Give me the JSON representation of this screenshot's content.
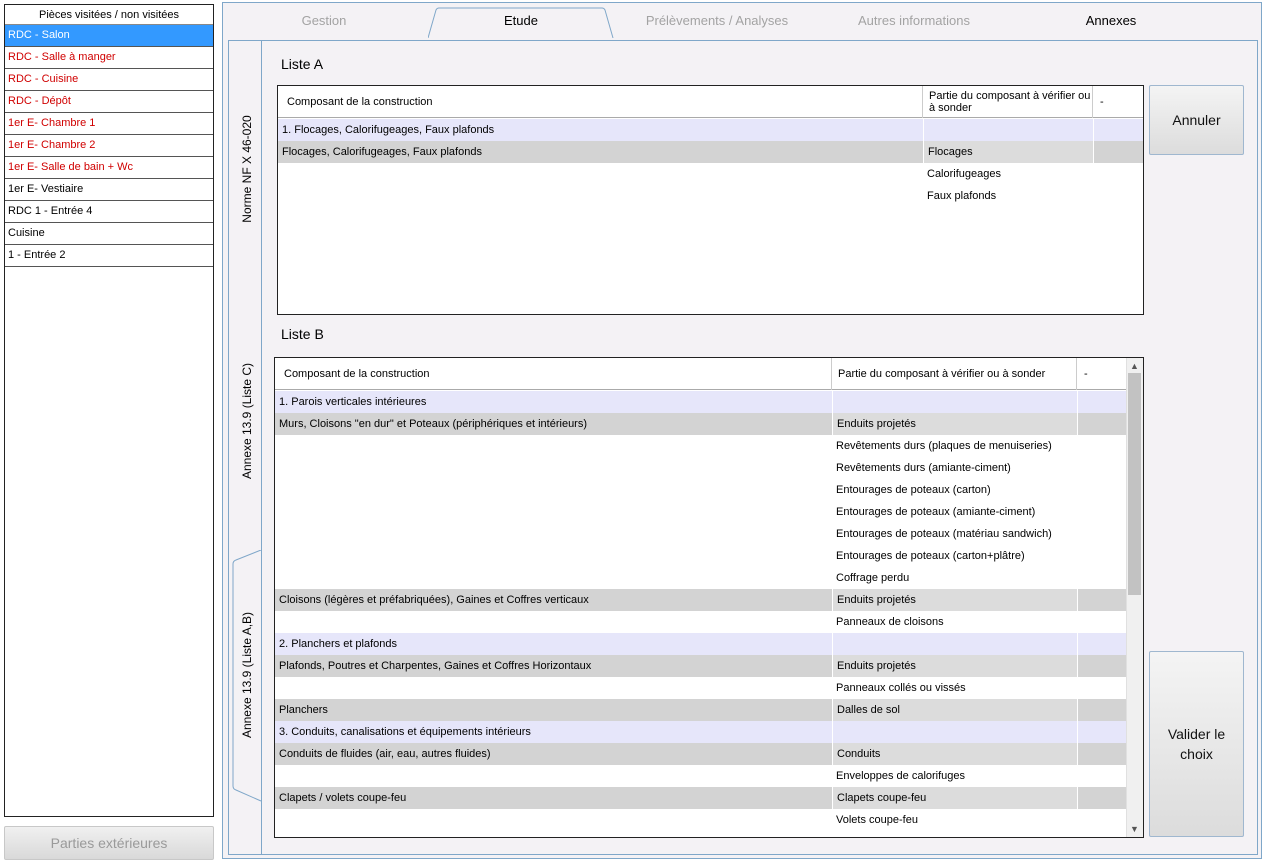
{
  "rooms": {
    "header": "Pièces visitées / non visitées",
    "items": [
      {
        "label": "RDC - Salon",
        "state": "selected"
      },
      {
        "label": "RDC - Salle à manger",
        "state": "red"
      },
      {
        "label": "RDC - Cuisine",
        "state": "red"
      },
      {
        "label": "RDC - Dépôt",
        "state": "red"
      },
      {
        "label": "1er E- Chambre 1",
        "state": "red"
      },
      {
        "label": "1er E- Chambre 2",
        "state": "red"
      },
      {
        "label": "1er E- Salle de bain + Wc",
        "state": "red"
      },
      {
        "label": "1er E- Vestiaire",
        "state": "normal"
      },
      {
        "label": "RDC 1 - Entrée 4",
        "state": "normal"
      },
      {
        "label": "Cuisine",
        "state": "normal"
      },
      {
        "label": "1 - Entrée 2",
        "state": "normal"
      }
    ],
    "exterior_button": "Parties extérieures"
  },
  "tabs": {
    "gestion": "Gestion",
    "etude": "Etude",
    "prelevements": "Prélèvements / Analyses",
    "autres": "Autres informations",
    "annexes": "Annexes"
  },
  "side_tabs": {
    "norme": "Norme NF X 46-020",
    "annexe_c": "Annexe 13.9 (Liste C)",
    "annexe_ab": "Annexe 13.9 (Liste A,B)"
  },
  "liste_a": {
    "title": "Liste A",
    "col1": "Composant de la construction",
    "col2": "Partie du composant à vérifier ou à sonder",
    "col3": "-",
    "rows": [
      {
        "type": "cat",
        "a": "1. Flocages, Calorifugeages, Faux plafonds",
        "b": ""
      },
      {
        "type": "grey",
        "a": "Flocages, Calorifugeages, Faux plafonds",
        "b": "Flocages"
      },
      {
        "type": "plain",
        "a": "",
        "b": "Calorifugeages"
      },
      {
        "type": "plain",
        "a": "",
        "b": "Faux plafonds"
      }
    ]
  },
  "liste_b": {
    "title": "Liste B",
    "col1": "Composant de la construction",
    "col2": "Partie du composant à vérifier ou à sonder",
    "col3": "-",
    "rows": [
      {
        "type": "cat",
        "a": "1. Parois verticales intérieures",
        "b": ""
      },
      {
        "type": "grey",
        "a": "Murs, Cloisons \"en dur\" et Poteaux (périphériques et intérieurs)",
        "b": "Enduits projetés"
      },
      {
        "type": "plain",
        "a": "",
        "b": "Revêtements durs (plaques de menuiseries)"
      },
      {
        "type": "plain",
        "a": "",
        "b": "Revêtements durs (amiante-ciment)"
      },
      {
        "type": "plain",
        "a": "",
        "b": "Entourages de poteaux (carton)"
      },
      {
        "type": "plain",
        "a": "",
        "b": "Entourages de poteaux (amiante-ciment)"
      },
      {
        "type": "plain",
        "a": "",
        "b": "Entourages de poteaux (matériau sandwich)"
      },
      {
        "type": "plain",
        "a": "",
        "b": "Entourages de poteaux (carton+plâtre)"
      },
      {
        "type": "plain",
        "a": "",
        "b": "Coffrage perdu"
      },
      {
        "type": "grey",
        "a": "Cloisons (légères et préfabriquées), Gaines et Coffres verticaux",
        "b": "Enduits projetés"
      },
      {
        "type": "plain",
        "a": "",
        "b": "Panneaux de cloisons"
      },
      {
        "type": "cat",
        "a": "2. Planchers et plafonds",
        "b": ""
      },
      {
        "type": "grey",
        "a": "Plafonds, Poutres et Charpentes, Gaines et Coffres Horizontaux",
        "b": "Enduits projetés"
      },
      {
        "type": "plain",
        "a": "",
        "b": "Panneaux collés ou vissés"
      },
      {
        "type": "grey",
        "a": "Planchers",
        "b": "Dalles de sol"
      },
      {
        "type": "cat",
        "a": "3. Conduits, canalisations et équipements intérieurs",
        "b": ""
      },
      {
        "type": "grey",
        "a": "Conduits de fluides (air, eau, autres fluides)",
        "b": "Conduits"
      },
      {
        "type": "plain",
        "a": "",
        "b": "Enveloppes de calorifuges"
      },
      {
        "type": "grey",
        "a": "Clapets / volets coupe-feu",
        "b": "Clapets coupe-feu"
      },
      {
        "type": "plain",
        "a": "",
        "b": "Volets coupe-feu"
      }
    ]
  },
  "buttons": {
    "annuler": "Annuler",
    "valider": "Valider le choix"
  }
}
